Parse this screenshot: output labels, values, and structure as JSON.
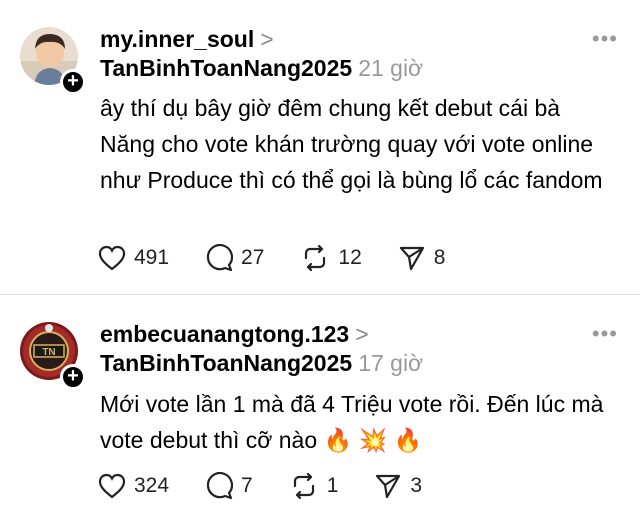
{
  "posts": [
    {
      "username": "my.inner_soul",
      "chevron": ">",
      "tag": "TanBinhToanNang2025",
      "time": "21 giờ",
      "more": "•••",
      "text": "ây thí dụ bây giờ đêm chung kết debut cái bà Năng cho vote khán trường quay với vote online như Produce thì có thể gọi là bùng lổ các fandom",
      "likes": "491",
      "comments": "27",
      "reposts": "12",
      "shares": "8",
      "avatar_icon": "profile-photo-boy"
    },
    {
      "username": "embecuanangtong.123",
      "chevron": ">",
      "tag": "TanBinhToanNang2025",
      "time": "17 giờ",
      "more": "•••",
      "text": "Mới vote lần 1 mà đã 4 Triệu vote rồi. Đến lúc mà vote debut thì cỡ nào 🔥 💥 🔥",
      "likes": "324",
      "comments": "7",
      "reposts": "1",
      "shares": "3",
      "avatar_icon": "profile-logo-emblem"
    }
  ],
  "icons": {
    "like": "heart-icon",
    "comment": "comment-icon",
    "repost": "repost-icon",
    "share": "send-icon",
    "follow": "plus-icon"
  }
}
